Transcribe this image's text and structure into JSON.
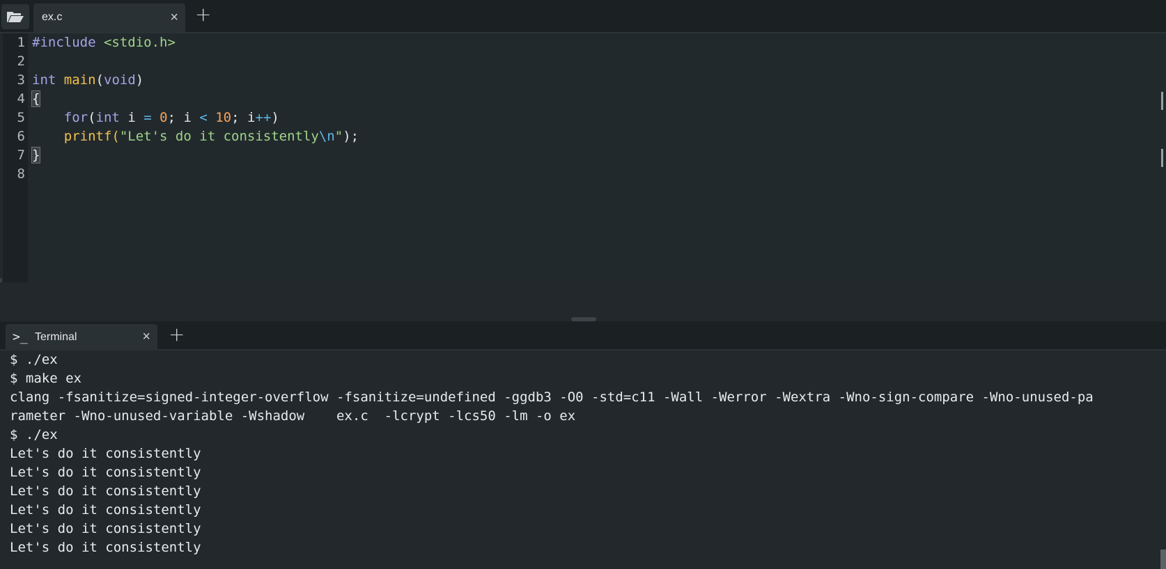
{
  "editor": {
    "tabs": [
      {
        "label": "ex.c",
        "close": "×"
      }
    ],
    "add_tab": "+",
    "line_numbers": [
      "1",
      "2",
      "3",
      "4",
      "5",
      "6",
      "7",
      "8"
    ]
  },
  "code": {
    "l1_include": "#include",
    "l1_header": " <stdio.h>",
    "l3_int": "int",
    "l3_main": "main",
    "l3_open": "(",
    "l3_void": "void",
    "l3_close": ")",
    "l4_brace": "{",
    "l5_indent": "    ",
    "l5_for": "for",
    "l5_paren": "(",
    "l5_int": "int",
    "l5_i1": " i ",
    "l5_eq": "=",
    "l5_sp": " ",
    "l5_zero": "0",
    "l5_semi1": "; i ",
    "l5_lt": "<",
    "l5_sp2": " ",
    "l5_ten": "10",
    "l5_semi2": "; i",
    "l5_inc": "++",
    "l5_close": ")",
    "l6_indent": "    ",
    "l6_printf": "printf",
    "l6_open": "(",
    "l6_str": "\"Let's do it consistently",
    "l6_esc": "\\n",
    "l6_str_end": "\"",
    "l6_close": ");",
    "l7_brace": "}"
  },
  "terminal": {
    "tab_icon": ">_",
    "tab_label": "Terminal",
    "close": "×",
    "add_tab": "+",
    "lines": [
      "$ ./ex",
      "$ make ex",
      "clang -fsanitize=signed-integer-overflow -fsanitize=undefined -ggdb3 -O0 -std=c11 -Wall -Werror -Wextra -Wno-sign-compare -Wno-unused-pa",
      "rameter -Wno-unused-variable -Wshadow    ex.c  -lcrypt -lcs50 -lm -o ex",
      "$ ./ex",
      "Let's do it consistently",
      "Let's do it consistently",
      "Let's do it consistently",
      "Let's do it consistently",
      "Let's do it consistently",
      "Let's do it consistently"
    ]
  }
}
